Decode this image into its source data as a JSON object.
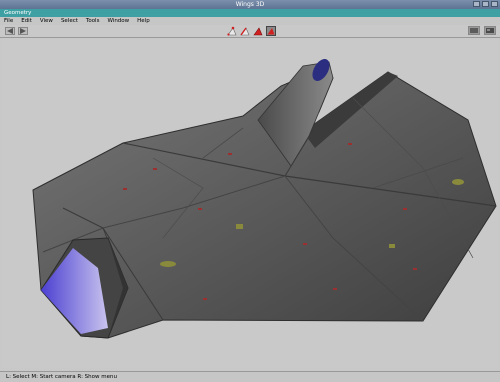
{
  "window": {
    "title": "Wings 3D"
  },
  "geometry_tab": {
    "label": "Geometry"
  },
  "menu": {
    "items": [
      {
        "label": "File"
      },
      {
        "label": "Edit"
      },
      {
        "label": "View"
      },
      {
        "label": "Select"
      },
      {
        "label": "Tools"
      },
      {
        "label": "Window"
      },
      {
        "label": "Help"
      }
    ]
  },
  "toolbar": {
    "left": [
      {
        "icon": "undo-icon"
      },
      {
        "icon": "redo-icon"
      }
    ],
    "selection_modes": [
      {
        "icon": "vertex-mode-icon"
      },
      {
        "icon": "edge-mode-icon"
      },
      {
        "icon": "face-mode-icon"
      },
      {
        "icon": "body-mode-icon",
        "active": true
      }
    ],
    "right": [
      {
        "icon": "perspective-icon"
      },
      {
        "icon": "view-options-icon"
      }
    ]
  },
  "colors": {
    "title_bar": "#6a7f9e",
    "geometry_tab": "#3fa0a3",
    "viewport_bg": "#c9c9c9",
    "model_hull": "#595959",
    "engine_glow": "#6c5ddb",
    "mode_red": "#d02020"
  },
  "status": {
    "text": "L: Select   M: Start camera   R: Show menu"
  }
}
